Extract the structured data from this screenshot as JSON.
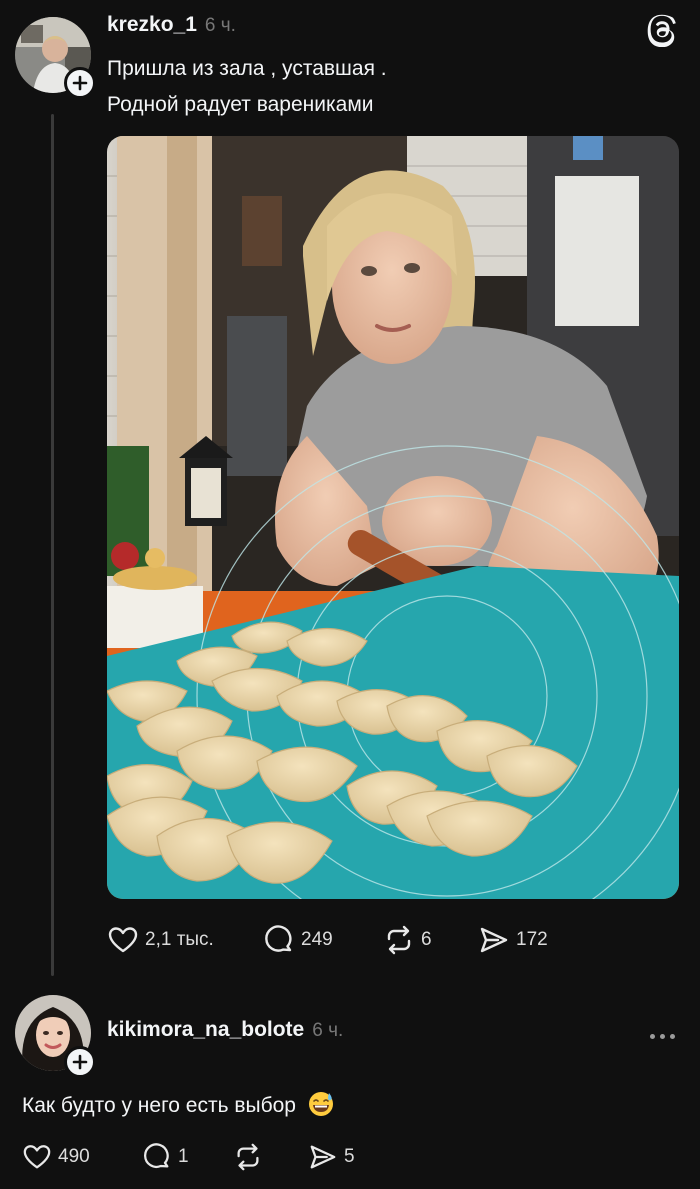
{
  "app": {
    "logo_icon": "threads-icon"
  },
  "post": {
    "author": "krezko_1",
    "time": "6 ч.",
    "text_line1": "Пришла из зала , уставшая .",
    "text_line2": "Родной радует варениками",
    "image": "photo-woman-making-dumplings",
    "actions": {
      "likes": "2,1 тыс.",
      "comments": "249",
      "reposts": "6",
      "shares": "172"
    }
  },
  "reply": {
    "author": "kikimora_na_bolote",
    "time": "6 ч.",
    "text": "Как будто у него есть выбор",
    "emoji": "grinning-face-with-sweat",
    "actions": {
      "likes": "490",
      "comments": "1",
      "reposts": "",
      "shares": "5"
    }
  },
  "colors": {
    "background": "#101010",
    "text": "#f3f5f7",
    "muted": "#777777",
    "thread_line": "#3a3a3a"
  }
}
